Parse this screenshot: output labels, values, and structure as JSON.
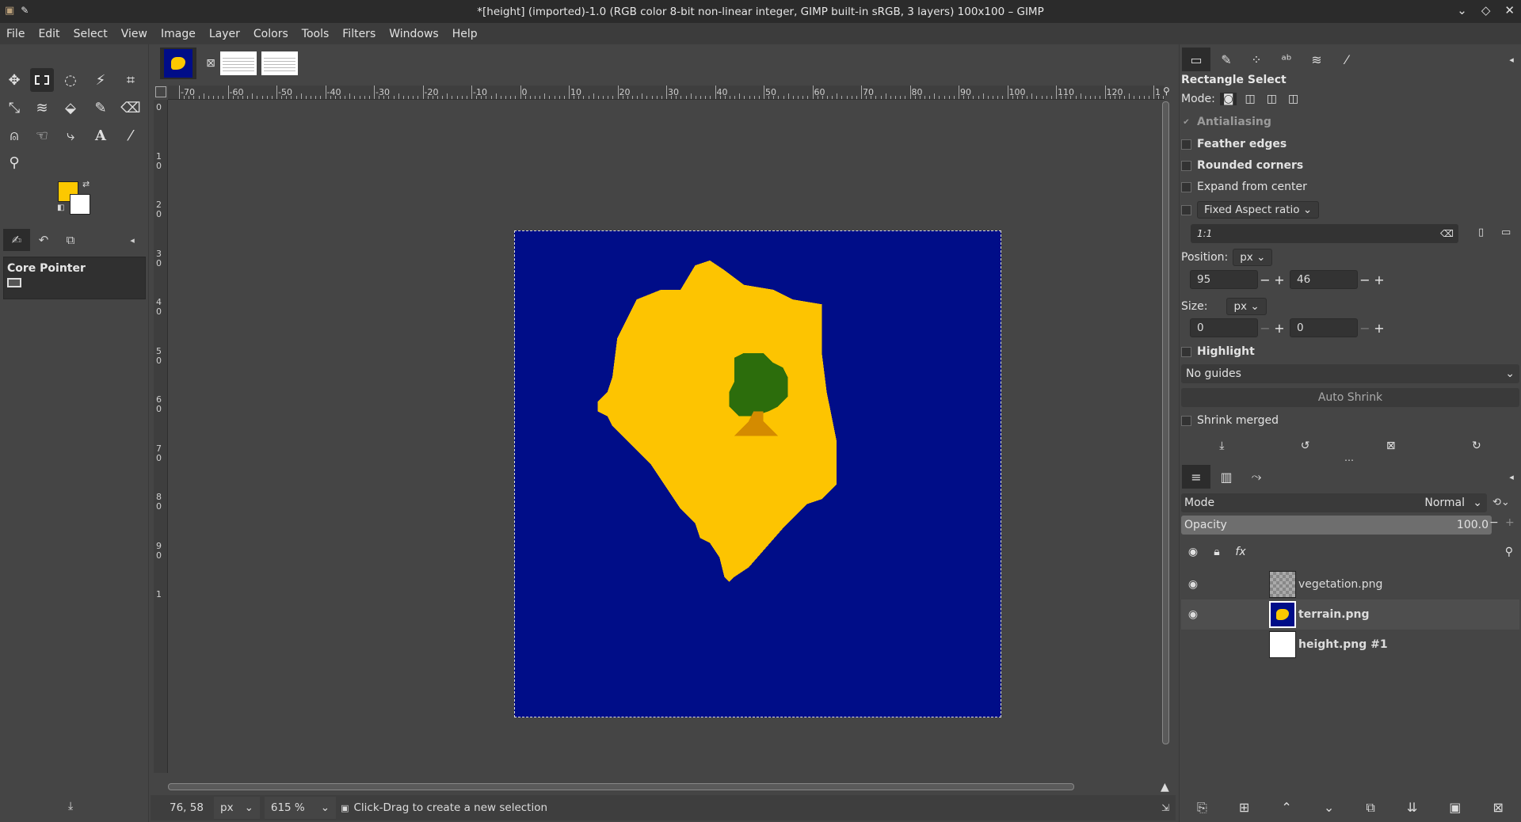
{
  "titlebar": {
    "title": "*[height] (imported)-1.0 (RGB color 8-bit non-linear integer, GIMP built-in sRGB, 3 layers) 100x100 – GIMP"
  },
  "menu": [
    "File",
    "Edit",
    "Select",
    "View",
    "Image",
    "Layer",
    "Colors",
    "Tools",
    "Filters",
    "Windows",
    "Help"
  ],
  "colors": {
    "foreground": "#fcc800",
    "background": "#ffffff",
    "canvas": "#000d88",
    "island": "#fdc401",
    "tree": "#2c6d0c",
    "trunk": "#d48b00"
  },
  "toolbox": {
    "device_status_title": "Core Pointer"
  },
  "rulers": {
    "h_labels": [
      "-70",
      "-60",
      "-50",
      "-40",
      "-30",
      "-20",
      "-10",
      "0",
      "10",
      "20",
      "30",
      "40",
      "50",
      "60",
      "70",
      "80",
      "90",
      "100",
      "110",
      "120",
      "1"
    ],
    "v_labels": [
      "0",
      "1 0",
      "2 0",
      "3 0",
      "4 0",
      "5 0",
      "6 0",
      "7 0",
      "8 0",
      "9 0",
      "1"
    ]
  },
  "statusbar": {
    "coords": "76, 58",
    "unit": "px",
    "zoom": "615 %",
    "message": "Click-Drag to create a new selection"
  },
  "tool_options": {
    "title": "Rectangle Select",
    "mode_label": "Mode:",
    "antialiasing": "Antialiasing",
    "feather": "Feather edges",
    "rounded": "Rounded corners",
    "expand": "Expand from center",
    "fixed": "Fixed Aspect ratio",
    "ratio_value": "1:1",
    "position_label": "Position:",
    "position_unit": "px",
    "pos_x": "95",
    "pos_y": "46",
    "size_label": "Size:",
    "size_unit": "px",
    "size_w": "0",
    "size_h": "0",
    "highlight": "Highlight",
    "guides": "No guides",
    "auto_shrink": "Auto Shrink",
    "shrink_merged": "Shrink merged"
  },
  "layers": {
    "mode_label": "Mode",
    "mode_value": "Normal",
    "opacity_label": "Opacity",
    "opacity_value": "100.0",
    "items": [
      {
        "name": "vegetation.png"
      },
      {
        "name": "terrain.png"
      },
      {
        "name": "height.png #1"
      }
    ]
  }
}
